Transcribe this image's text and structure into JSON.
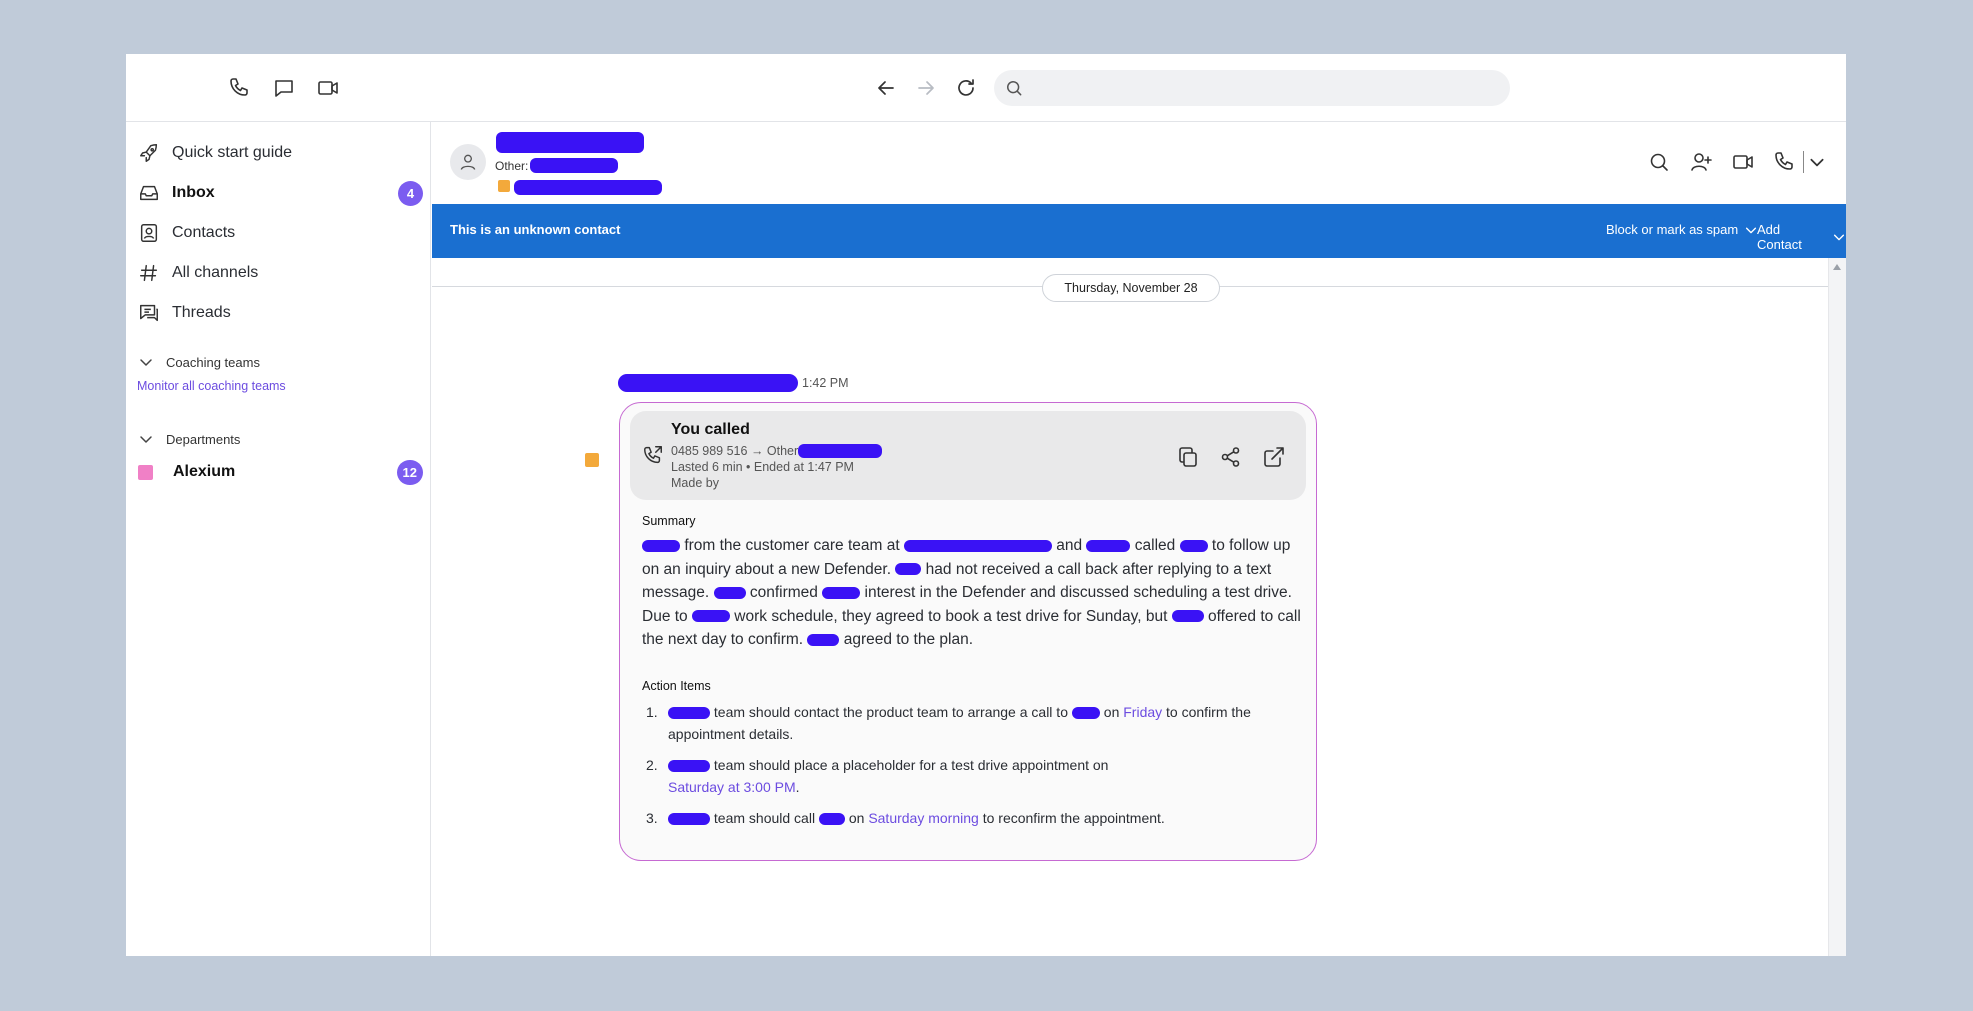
{
  "colors": {
    "accent": "#7b5cf0",
    "banner": "#1a6fd0",
    "redaction": "#3a12f5",
    "highlight_text": "#6c4ce0",
    "card_border": "#c66ad2",
    "department_swatch": "#f080c6",
    "contact_marker": "#f3a93b"
  },
  "toolbar": {
    "search": {
      "value": "",
      "placeholder": ""
    }
  },
  "sidebar": {
    "items": [
      {
        "label": "Quick start guide",
        "icon": "rocket-icon"
      },
      {
        "label": "Inbox",
        "icon": "inbox-icon",
        "badge": "4"
      },
      {
        "label": "Contacts",
        "icon": "contacts-icon"
      },
      {
        "label": "All channels",
        "icon": "hash-icon"
      },
      {
        "label": "Threads",
        "icon": "threads-icon"
      }
    ],
    "coaching": {
      "title": "Coaching teams",
      "link": "Monitor all coaching teams"
    },
    "departments": {
      "title": "Departments",
      "items": [
        {
          "label": "Alexium",
          "badge": "12"
        }
      ]
    }
  },
  "contact": {
    "other_label": "Other:"
  },
  "banner": {
    "text": "This is an unknown contact",
    "block_label": "Block or mark as spam",
    "add_label": "Add Contact"
  },
  "conversation": {
    "date": "Thursday, November 28",
    "message_time": "1:42 PM",
    "call": {
      "title": "You called",
      "route_prefix": "0485 989 516 → Other",
      "duration": "Lasted 6 min • Ended at 1:47 PM",
      "made_by": "Made by"
    },
    "summary": {
      "label": "Summary",
      "t1": "from the customer care team at",
      "t2": "and",
      "t3": "called",
      "t4": "to follow up on an inquiry about a new Defender.",
      "t5": "had not received a call back after replying to a text message.",
      "t6": "confirmed",
      "t7": "interest in the Defender and discussed scheduling a test drive. Due to",
      "t8": "work schedule, they agreed to book a test drive for Sunday, but",
      "t9": "offered to call the next day to confirm.",
      "t10": "agreed to the plan."
    },
    "actions": {
      "label": "Action Items",
      "items": [
        {
          "num": "1.",
          "a": "team should contact the product team to arrange a call to",
          "b": "on",
          "hl": "Friday",
          "c": "to confirm the appointment details."
        },
        {
          "num": "2.",
          "a": "team should place a placeholder for a test drive appointment on",
          "hl": "Saturday at 3:00 PM",
          "c": "."
        },
        {
          "num": "3.",
          "a": "team should call",
          "b": "on",
          "hl": "Saturday morning",
          "c": "to reconfirm the appointment."
        }
      ]
    }
  }
}
